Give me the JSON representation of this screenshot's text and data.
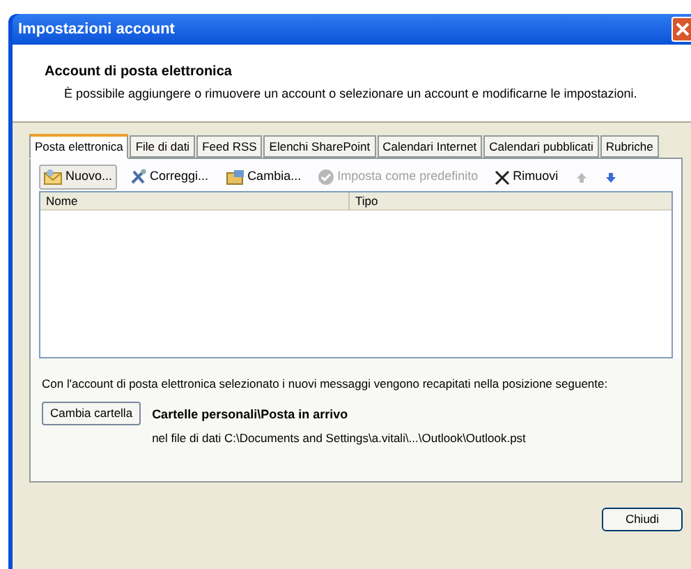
{
  "window": {
    "title": "Impostazioni account"
  },
  "header": {
    "title": "Account di posta elettronica",
    "description": "È possibile aggiungere o rimuovere un account o selezionare un account e modificarne le impostazioni."
  },
  "tabs": [
    {
      "label": "Posta elettronica",
      "selected": true
    },
    {
      "label": "File di dati",
      "selected": false
    },
    {
      "label": "Feed RSS",
      "selected": false
    },
    {
      "label": "Elenchi SharePoint",
      "selected": false
    },
    {
      "label": "Calendari Internet",
      "selected": false
    },
    {
      "label": "Calendari pubblicati",
      "selected": false
    },
    {
      "label": "Rubriche",
      "selected": false
    }
  ],
  "toolbar": [
    {
      "kind": "new",
      "label": "Nuovo...",
      "disabled": false,
      "hovered": true
    },
    {
      "kind": "repair",
      "label": "Correggi...",
      "disabled": false,
      "hovered": false
    },
    {
      "kind": "change",
      "label": "Cambia...",
      "disabled": false,
      "hovered": false
    },
    {
      "kind": "default",
      "label": "Imposta come predefinito",
      "disabled": true,
      "hovered": false
    },
    {
      "kind": "remove",
      "label": "Rimuovi",
      "disabled": false,
      "hovered": false
    },
    {
      "kind": "up",
      "disabled": true,
      "hovered": false
    },
    {
      "kind": "down",
      "disabled": false,
      "hovered": false
    }
  ],
  "table": {
    "columns": [
      "Nome",
      "Tipo"
    ]
  },
  "delivery": {
    "text": "Con l'account di posta elettronica selezionato i nuovi messaggi vengono recapitati nella posizione seguente:",
    "button": "Cambia cartella",
    "folder": "Cartelle personali\\Posta in arrivo",
    "path": "nel file di dati C:\\Documents and Settings\\a.vitali\\...\\Outlook\\Outlook.pst"
  },
  "buttons": [
    "Chiudi"
  ]
}
